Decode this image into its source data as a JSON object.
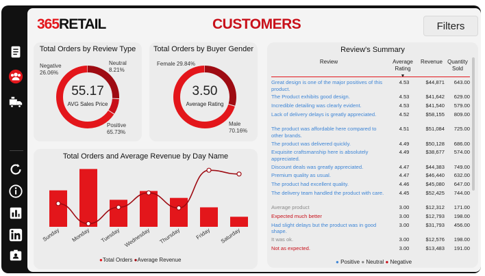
{
  "header": {
    "logo_num": "365",
    "logo_word": "RETAIL",
    "title": "CUSTOMERS",
    "filters_label": "Filters"
  },
  "sidebar": {
    "items": [
      {
        "icon": "document-icon"
      },
      {
        "icon": "users-icon"
      },
      {
        "icon": "truck-icon"
      },
      {
        "icon": "refresh-icon"
      },
      {
        "icon": "info-icon"
      },
      {
        "icon": "chart-icon"
      },
      {
        "icon": "linkedin-icon"
      },
      {
        "icon": "badge-icon"
      }
    ]
  },
  "review_type_card": {
    "title": "Total Orders by Review Type",
    "center_value": "55.17",
    "center_label": "AVG Sales Price",
    "labels": {
      "negative": "Negative",
      "negative_pct": "26.06%",
      "neutral": "Neutral",
      "neutral_pct": "8.21%",
      "positive": "Positive",
      "positive_pct": "65.73%"
    }
  },
  "gender_card": {
    "title": "Total Orders by Buyer Gender",
    "center_value": "3.50",
    "center_label": "Average Rating",
    "labels": {
      "female": "Female 29.84%",
      "male": "Male",
      "male_pct": "70.16%"
    }
  },
  "day_card": {
    "title": "Total Orders and Average Revenue by Day Name",
    "legend_orders": "Total Orders",
    "legend_revenue": "Average Revenue"
  },
  "chart_data": [
    {
      "type": "pie",
      "title": "Total Orders by Review Type",
      "categories": [
        "Negative",
        "Neutral",
        "Positive"
      ],
      "values": [
        26.06,
        8.21,
        65.73
      ],
      "colors": [
        "#9e0b12",
        "#c8101a",
        "#e3161b"
      ]
    },
    {
      "type": "pie",
      "title": "Total Orders by Buyer Gender",
      "categories": [
        "Female",
        "Male"
      ],
      "values": [
        29.84,
        70.16
      ],
      "colors": [
        "#9e0b12",
        "#e3161b"
      ]
    },
    {
      "type": "bar",
      "title": "Total Orders and Average Revenue by Day Name",
      "categories": [
        "Sunday",
        "Monday",
        "Tuesday",
        "Wednesday",
        "Thursday",
        "Friday",
        "Saturday"
      ],
      "series": [
        {
          "name": "Total Orders",
          "values": [
            58,
            92,
            43,
            57,
            46,
            31,
            16
          ]
        },
        {
          "name": "Average Revenue",
          "values": [
            37,
            5,
            31,
            54,
            30,
            90,
            84
          ]
        }
      ],
      "colors": [
        "#e3161b",
        "#9e0b12"
      ]
    }
  ],
  "summary": {
    "title": "Review's Summary",
    "columns": [
      "Review",
      "Average Rating",
      "Revenue",
      "Quantity Sold"
    ],
    "rows": [
      {
        "review": "Great design is one of the major positives of this product.",
        "rating": "4.53",
        "revenue": "$44,871",
        "qty": "643.00",
        "sentiment": "pos"
      },
      {
        "review": "The Product exhibits good design.",
        "rating": "4.53",
        "revenue": "$41,642",
        "qty": "629.00",
        "sentiment": "pos"
      },
      {
        "review": "Incredible detailing was clearly evident.",
        "rating": "4.53",
        "revenue": "$41,540",
        "qty": "579.00",
        "sentiment": "pos"
      },
      {
        "review": "Lack of delivery delays is greatly appreciated.",
        "rating": "4.52",
        "revenue": "$58,155",
        "qty": "809.00",
        "sentiment": "pos"
      },
      {
        "review": "The product was affordable here compared to other brands.",
        "rating": "4.51",
        "revenue": "$51,084",
        "qty": "725.00",
        "sentiment": "pos"
      },
      {
        "review": "The product was delivered quickly.",
        "rating": "4.49",
        "revenue": "$50,128",
        "qty": "686.00",
        "sentiment": "pos"
      },
      {
        "review": "Exquisite craftsmanship here is absolutely appreciated.",
        "rating": "4.49",
        "revenue": "$38,677",
        "qty": "574.00",
        "sentiment": "pos"
      },
      {
        "review": "Discount deals was greatly appreciated.",
        "rating": "4.47",
        "revenue": "$44,383",
        "qty": "749.00",
        "sentiment": "pos"
      },
      {
        "review": "Premium quality as usual.",
        "rating": "4.47",
        "revenue": "$46,440",
        "qty": "632.00",
        "sentiment": "pos"
      },
      {
        "review": "The product had excellent quality.",
        "rating": "4.46",
        "revenue": "$45,080",
        "qty": "647.00",
        "sentiment": "pos"
      },
      {
        "review": "The delivery team handled the product with care.",
        "rating": "4.45",
        "revenue": "$52,425",
        "qty": "744.00",
        "sentiment": "pos"
      },
      {
        "review": "Average product",
        "rating": "3.00",
        "revenue": "$12,312",
        "qty": "171.00",
        "sentiment": "neu"
      },
      {
        "review": "Expected much better",
        "rating": "3.00",
        "revenue": "$12,793",
        "qty": "198.00",
        "sentiment": "neg"
      },
      {
        "review": "Had slight delays but the product was in good shape.",
        "rating": "3.00",
        "revenue": "$31,793",
        "qty": "456.00",
        "sentiment": "pos"
      },
      {
        "review": "It was ok.",
        "rating": "3.00",
        "revenue": "$12,576",
        "qty": "198.00",
        "sentiment": "neu"
      },
      {
        "review": "Not as expected.",
        "rating": "3.00",
        "revenue": "$13,483",
        "qty": "191.00",
        "sentiment": "neg"
      }
    ],
    "legend": {
      "positive": "Positive",
      "neutral": "Neutral",
      "negative": "Negative"
    },
    "colors": {
      "positive": "#3f86d6",
      "neutral": "#8a8a8a",
      "negative": "#c8101a"
    }
  }
}
